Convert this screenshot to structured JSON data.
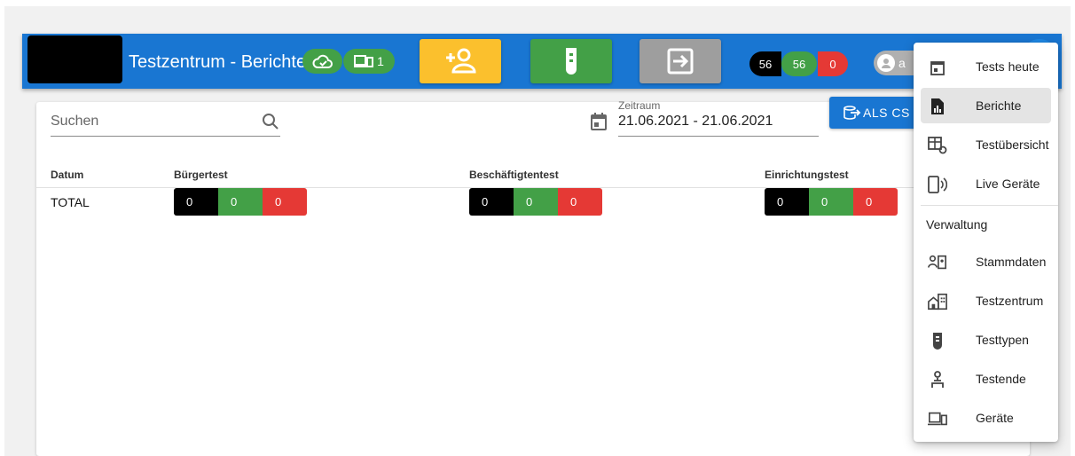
{
  "app": {
    "title": "Testzentrum - Berichte",
    "devices_count": "1",
    "accent_color": "#1976d2",
    "user_initial": "a"
  },
  "toolbar": {
    "add_person_icon": "add-person-icon",
    "test_tube_icon": "test-tube-icon",
    "exit_icon": "exit-icon"
  },
  "counters": {
    "total": "56",
    "negative": "56",
    "positive": "0"
  },
  "search": {
    "placeholder": "Suchen"
  },
  "date_range": {
    "label": "Zeitraum",
    "value": "21.06.2021 - 21.06.2021"
  },
  "export": {
    "label": "ALS CS"
  },
  "table": {
    "headers": [
      "Datum",
      "Bürgertest",
      "Beschäftigtentest",
      "Einrichtungstest"
    ],
    "rows": [
      {
        "datum": "TOTAL",
        "buergertest": {
          "total": "0",
          "negative": "0",
          "positive": "0"
        },
        "beschaeftigtentest": {
          "total": "0",
          "negative": "0",
          "positive": "0"
        },
        "einrichtungstest": {
          "total": "0",
          "negative": "0",
          "positive": "0"
        }
      }
    ]
  },
  "menu": {
    "items": [
      {
        "label": "Tests heute",
        "icon": "calendar-icon"
      },
      {
        "label": "Berichte",
        "icon": "report-icon",
        "active": true
      },
      {
        "label": "Testübersicht",
        "icon": "table-settings-icon"
      },
      {
        "label": "Live Geräte",
        "icon": "device-live-icon"
      }
    ],
    "section_title": "Verwaltung",
    "admin_items": [
      {
        "label": "Stammdaten",
        "icon": "master-data-icon"
      },
      {
        "label": "Testzentrum",
        "icon": "building-icon"
      },
      {
        "label": "Testtypen",
        "icon": "test-tube-icon"
      },
      {
        "label": "Testende",
        "icon": "people-icon"
      },
      {
        "label": "Geräte",
        "icon": "devices-icon"
      }
    ]
  }
}
